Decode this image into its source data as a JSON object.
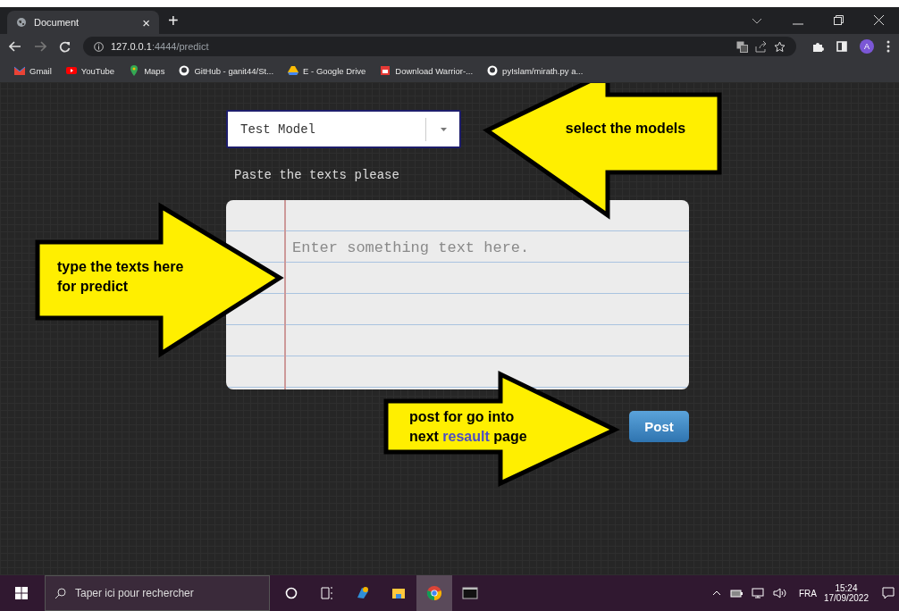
{
  "browser": {
    "tab": {
      "title": "Document",
      "close": "×",
      "selected": true
    },
    "new_tab": "+",
    "url": {
      "host": "127.0.0.1",
      "path": ":4444/predict"
    },
    "avatar": "A",
    "bookmarks": [
      {
        "label": "Gmail",
        "kind": "gmail"
      },
      {
        "label": "YouTube",
        "kind": "youtube"
      },
      {
        "label": "Maps",
        "kind": "maps"
      },
      {
        "label": "GitHub - ganit44/St...",
        "kind": "github"
      },
      {
        "label": "E - Google Drive",
        "kind": "drive"
      },
      {
        "label": "Download Warrior-...",
        "kind": "store"
      },
      {
        "label": "pyIslam/mirath.py a...",
        "kind": "github"
      }
    ]
  },
  "page": {
    "model_select": {
      "value": "Test Model"
    },
    "prompt": "Paste the texts please",
    "text_area": {
      "placeholder": "Enter something text here."
    },
    "post_button": "Post"
  },
  "callouts": [
    {
      "kind": "left",
      "lines": [
        "select the models"
      ]
    },
    {
      "kind": "right-mid",
      "lines": [
        "type the texts here",
        "for predict"
      ]
    },
    {
      "kind": "right-low",
      "lines": [
        "post for go into"
      ],
      "before": "next ",
      "highlight": "resault",
      "after": " page"
    }
  ],
  "taskbar": {
    "search": {
      "placeholder": "Taper ici pour rechercher"
    },
    "apps": [
      {
        "kind": "cortana",
        "selected": false
      },
      {
        "kind": "taskview",
        "selected": false
      },
      {
        "kind": "paint",
        "selected": false
      },
      {
        "kind": "explorer",
        "selected": false
      },
      {
        "kind": "chrome",
        "selected": true
      },
      {
        "kind": "terminal",
        "selected": false
      }
    ],
    "language": "FRA",
    "time": "15:24",
    "date": "17/09/2022"
  }
}
